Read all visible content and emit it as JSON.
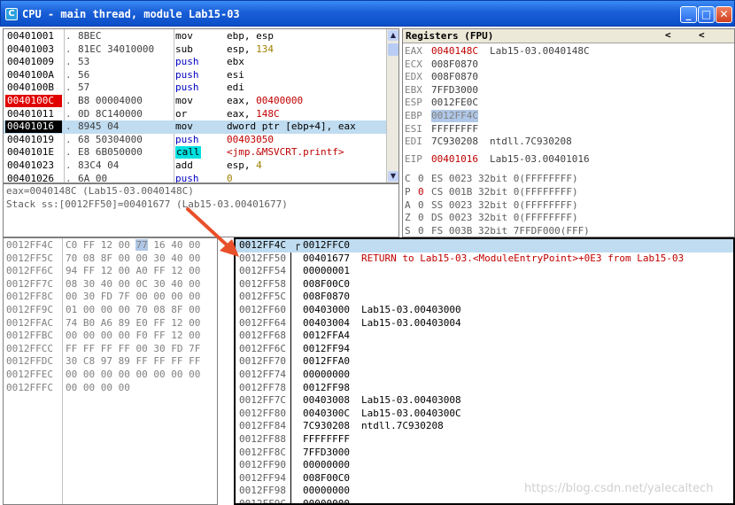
{
  "window": {
    "title": "CPU - main thread, module Lab15-03",
    "icon_letter": "C",
    "btn_min": "_",
    "btn_max": "□",
    "btn_close": "✕"
  },
  "disasm": {
    "rows": [
      {
        "addr": "00401001",
        "mark": ".",
        "hex": "8BEC",
        "mn": "mov",
        "op": "ebp, esp"
      },
      {
        "addr": "00401003",
        "mark": ".",
        "hex": "81EC 34010000",
        "mn": "sub",
        "op_a": "esp, ",
        "op_b": "134"
      },
      {
        "addr": "00401009",
        "mark": ".",
        "hex": "53",
        "mn": "push",
        "op": "ebx"
      },
      {
        "addr": "0040100A",
        "mark": ".",
        "hex": "56",
        "mn": "push",
        "op": "esi"
      },
      {
        "addr": "0040100B",
        "mark": ".",
        "hex": "57",
        "mn": "push",
        "op": "edi"
      },
      {
        "addr": "0040100C",
        "mark": ".",
        "hex": "B8 00004000",
        "mn": "mov",
        "op_a": "eax, ",
        "op_b": "00400000"
      },
      {
        "addr": "00401011",
        "mark": ".",
        "hex": "0D 8C140000",
        "mn": "or",
        "op_a": "eax, ",
        "op_b": "148C"
      },
      {
        "addr": "00401016",
        "mark": ".",
        "hex": "8945 04",
        "mn": "mov",
        "op": "dword ptr [ebp+4], eax"
      },
      {
        "addr": "00401019",
        "mark": ".",
        "hex": "68 50304000",
        "mn": "push",
        "op": "00403050"
      },
      {
        "addr": "0040101E",
        "mark": ".",
        "hex": "E8 6B050000",
        "mn": "call",
        "op": "<jmp.&MSVCRT.printf>"
      },
      {
        "addr": "00401023",
        "mark": ".",
        "hex": "83C4 04",
        "mn": "add",
        "op_a": "esp, ",
        "op_b": "4"
      },
      {
        "addr": "00401026",
        "mark": ".",
        "hex": "6A 00",
        "mn": "push",
        "op": "0"
      }
    ]
  },
  "info": {
    "line1": "eax=0040148C (Lab15-03.0040148C)",
    "line2": "Stack ss:[0012FF50]=00401677 (Lab15-03.00401677)"
  },
  "registers": {
    "title": "Registers (FPU)",
    "arrow_left": "<",
    "arrow_right": "<",
    "regs": [
      {
        "name": "EAX",
        "val": "0040148C",
        "cmt": "Lab15-03.0040148C"
      },
      {
        "name": "ECX",
        "val": "008F0870",
        "cmt": ""
      },
      {
        "name": "EDX",
        "val": "008F0870",
        "cmt": ""
      },
      {
        "name": "EBX",
        "val": "7FFD3000",
        "cmt": ""
      },
      {
        "name": "ESP",
        "val": "0012FE0C",
        "cmt": ""
      },
      {
        "name": "EBP",
        "val": "0012FF4C",
        "cmt": ""
      },
      {
        "name": "ESI",
        "val": "FFFFFFFF",
        "cmt": ""
      },
      {
        "name": "EDI",
        "val": "7C930208",
        "cmt": "ntdll.7C930208"
      }
    ],
    "eip": {
      "name": "EIP",
      "val": "00401016",
      "cmt": "Lab15-03.00401016"
    },
    "flags": [
      {
        "f": "C",
        "v": "0",
        "rest": "ES 0023 32bit 0(FFFFFFFF)"
      },
      {
        "f": "P",
        "v": "0",
        "rest": "CS 001B 32bit 0(FFFFFFFF)"
      },
      {
        "f": "A",
        "v": "0",
        "rest": "SS 0023 32bit 0(FFFFFFFF)"
      },
      {
        "f": "Z",
        "v": "0",
        "rest": "DS 0023 32bit 0(FFFFFFFF)"
      },
      {
        "f": "S",
        "v": "0",
        "rest": "FS 003B 32bit 7FFDF000(FFF)"
      }
    ]
  },
  "dump": {
    "rows": [
      {
        "addr": "0012FF4C",
        "hex_a": "C0 FF 12 00 ",
        "hex_sel": "77",
        "hex_b": " 16 40 00"
      },
      {
        "addr": "0012FF5C",
        "hex": "70 08 8F 00 00 30 40 00"
      },
      {
        "addr": "0012FF6C",
        "hex": "94 FF 12 00 A0 FF 12 00"
      },
      {
        "addr": "0012FF7C",
        "hex": "08 30 40 00 0C 30 40 00"
      },
      {
        "addr": "0012FF8C",
        "hex": "00 30 FD 7F 00 00 00 00"
      },
      {
        "addr": "0012FF9C",
        "hex": "01 00 00 00 70 08 8F 00"
      },
      {
        "addr": "0012FFAC",
        "hex": "74 B0 A6 89 E0 FF 12 00"
      },
      {
        "addr": "0012FFBC",
        "hex": "00 00 00 00 F0 FF 12 00"
      },
      {
        "addr": "0012FFCC",
        "hex": "FF FF FF FF 00 30 FD 7F"
      },
      {
        "addr": "0012FFDC",
        "hex": "30 C8 97 89 FF FF FF FF"
      },
      {
        "addr": "0012FFEC",
        "hex": "00 00 00 00 00 00 00 00"
      },
      {
        "addr": "0012FFFC",
        "hex": "00 00 00 00"
      }
    ]
  },
  "stack": {
    "rows": [
      {
        "addr": "0012FF4C",
        "val": "0012FFC0",
        "cmt": ""
      },
      {
        "addr": "0012FF50",
        "val": "00401677",
        "cmt": "RETURN to Lab15-03.<ModuleEntryPoint>+0E3 from Lab15-03"
      },
      {
        "addr": "0012FF54",
        "val": "00000001",
        "cmt": ""
      },
      {
        "addr": "0012FF58",
        "val": "008F00C0",
        "cmt": ""
      },
      {
        "addr": "0012FF5C",
        "val": "008F0870",
        "cmt": ""
      },
      {
        "addr": "0012FF60",
        "val": "00403000",
        "cmt": "Lab15-03.00403000"
      },
      {
        "addr": "0012FF64",
        "val": "00403004",
        "cmt": "Lab15-03.00403004"
      },
      {
        "addr": "0012FF68",
        "val": "0012FFA4",
        "cmt": ""
      },
      {
        "addr": "0012FF6C",
        "val": "0012FF94",
        "cmt": ""
      },
      {
        "addr": "0012FF70",
        "val": "0012FFA0",
        "cmt": ""
      },
      {
        "addr": "0012FF74",
        "val": "00000000",
        "cmt": ""
      },
      {
        "addr": "0012FF78",
        "val": "0012FF98",
        "cmt": ""
      },
      {
        "addr": "0012FF7C",
        "val": "00403008",
        "cmt": "Lab15-03.00403008"
      },
      {
        "addr": "0012FF80",
        "val": "0040300C",
        "cmt": "Lab15-03.0040300C"
      },
      {
        "addr": "0012FF84",
        "val": "7C930208",
        "cmt": "ntdll.7C930208"
      },
      {
        "addr": "0012FF88",
        "val": "FFFFFFFF",
        "cmt": ""
      },
      {
        "addr": "0012FF8C",
        "val": "7FFD3000",
        "cmt": ""
      },
      {
        "addr": "0012FF90",
        "val": "00000000",
        "cmt": ""
      },
      {
        "addr": "0012FF94",
        "val": "008F00C0",
        "cmt": ""
      },
      {
        "addr": "0012FF98",
        "val": "00000000",
        "cmt": ""
      },
      {
        "addr": "0012FF9C",
        "val": "00000000",
        "cmt": ""
      }
    ]
  },
  "colors": {
    "accent_red": "#c00000",
    "highlight": "#c0dcf0",
    "arrow": "#e8502a"
  },
  "watermark": "https://blog.csdn.net/yalecaltech"
}
